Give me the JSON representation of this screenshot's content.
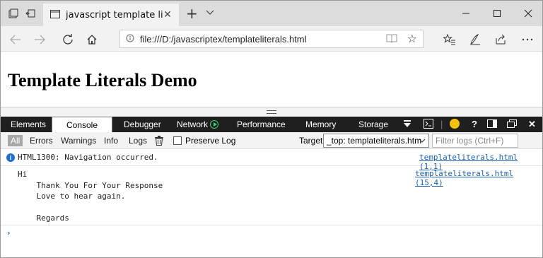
{
  "tabbar": {
    "tab_title": "javascript template literal",
    "new_tab": "+",
    "icons": [
      "tab-actions-icon",
      "set-tabs-aside-icon",
      "page-icon",
      "close-icon",
      "tab-list-icon",
      "minimize-icon",
      "maximize-icon",
      "close-window-icon"
    ]
  },
  "navbar": {
    "url": "file:///D:/javascriptex/templateliterals.html",
    "icons": [
      "back-icon",
      "forward-icon",
      "refresh-icon",
      "home-icon",
      "info-icon",
      "reading-view-icon",
      "favorite-star-icon",
      "favorites-icon",
      "notes-icon",
      "share-icon",
      "more-icon"
    ]
  },
  "page": {
    "heading": "Template Literals Demo"
  },
  "devtools": {
    "tabs": [
      "Elements",
      "Console",
      "Debugger",
      "Network",
      "Performance",
      "Memory",
      "Storage"
    ],
    "active_tab": "Console",
    "right_icons": [
      "overflow-menu-icon",
      "console-drawer-icon",
      "feedback-smile-icon",
      "help-icon",
      "dock-icon",
      "undock-icon",
      "close-devtools-icon"
    ],
    "help_glyph": "?",
    "close_glyph": "✕"
  },
  "console_toolbar": {
    "filters": [
      "All",
      "Errors",
      "Warnings",
      "Info",
      "Logs"
    ],
    "active_filter": "All",
    "preserve_log": "Preserve Log",
    "preserve_checked": false,
    "target_label": "Target",
    "target_value": "_top: templateliterals.htm",
    "filter_placeholder": "Filter logs (Ctrl+F)"
  },
  "console": {
    "messages": [
      {
        "type": "info",
        "text": "HTML1300: Navigation occurred.",
        "source": "templateliterals.html (1,1)"
      },
      {
        "type": "log",
        "text": "Hi\n    Thank You For Your Response\n    Love to hear again.\n\n    Regards",
        "source": "templateliterals.html (15,4)"
      }
    ],
    "prompt": "›"
  },
  "colors": {
    "devtools_bar": "#1f1f1f",
    "link": "#1a5fb4",
    "info_icon": "#1f6fd1",
    "network_green": "#3cd36b",
    "smile_yellow": "#f4c20d"
  }
}
